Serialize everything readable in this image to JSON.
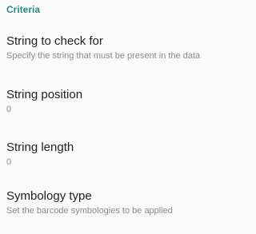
{
  "section": {
    "title": "Criteria"
  },
  "items": [
    {
      "title": "String to check for",
      "summary": "Specify the string that must be present in the data"
    },
    {
      "title": "String position",
      "summary": "0"
    },
    {
      "title": "String length",
      "summary": "0"
    },
    {
      "title": "Symbology type",
      "summary": "Set the barcode symbologies to be applied"
    }
  ]
}
